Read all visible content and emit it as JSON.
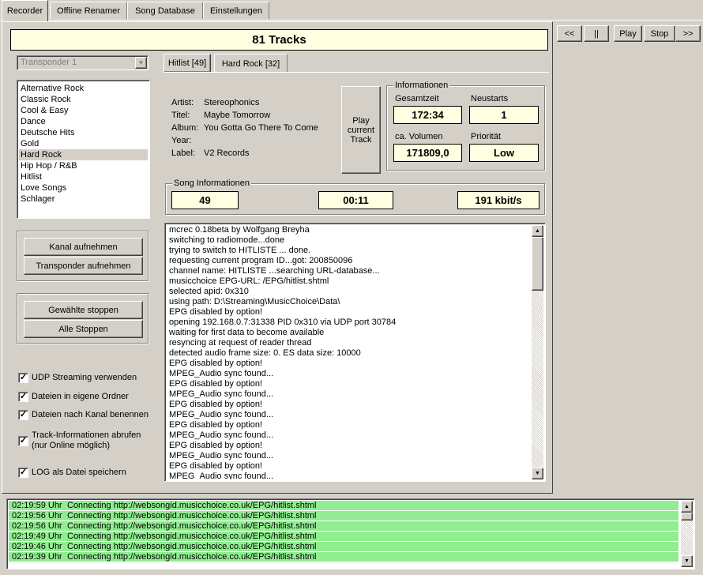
{
  "tabs": [
    {
      "label": "Recorder",
      "active": true
    },
    {
      "label": "Offline Renamer",
      "active": false
    },
    {
      "label": "Song Database",
      "active": false
    },
    {
      "label": "Einstellungen",
      "active": false
    }
  ],
  "player": {
    "prev": "<<",
    "pause": "||",
    "play": "Play",
    "stop": "Stop",
    "next": ">>"
  },
  "track_count": "81 Tracks",
  "transponder": {
    "selected": "Transponder 1"
  },
  "channels": [
    "Alternative Rock",
    "Classic Rock",
    "Cool & Easy",
    "Dance",
    "Deutsche Hits",
    "Gold",
    "Hard Rock",
    "Hip Hop / R&B",
    "Hitlist",
    "Love Songs",
    "Schlager"
  ],
  "selected_channel": "Hard Rock",
  "record_buttons": {
    "channel": "Kanal aufnehmen",
    "transponder": "Transponder aufnehmen"
  },
  "stop_buttons": {
    "selected": "Gewählte stoppen",
    "all": "Alle Stoppen"
  },
  "options": [
    {
      "label": "UDP Streaming verwenden",
      "checked": true
    },
    {
      "label": "Dateien in eigene Ordner",
      "checked": true
    },
    {
      "label": "Dateien nach Kanal benennen",
      "checked": true
    },
    {
      "label": "Track-Informationen abrufen",
      "sublabel": "(nur Online möglich)",
      "checked": true
    },
    {
      "label": "LOG als Datei speichern",
      "checked": true
    }
  ],
  "channel_tabs": [
    {
      "label": "Hitlist [49]",
      "active": true
    },
    {
      "label": "Hard Rock [32]",
      "active": false
    }
  ],
  "track": {
    "artist_label": "Artist:",
    "artist": "Stereophonics",
    "title_label": "Titel:",
    "title": "Maybe Tomorrow",
    "album_label": "Album:",
    "album": "You Gotta Go There To Come",
    "year_label": "Year:",
    "year": "",
    "label_label": "Label:",
    "label": "V2 Records"
  },
  "play_current": "Play current Track",
  "info": {
    "title": "Informationen",
    "total_label": "Gesamtzeit",
    "total": "172:34",
    "restarts_label": "Neustarts",
    "restarts": "1",
    "volume_label": "ca. Volumen",
    "volume": "171809,0",
    "priority_label": "Priorität",
    "priority": "Low"
  },
  "song_info": {
    "title": "Song Informationen",
    "number": "49",
    "time": "00:11",
    "bitrate": "191 kbit/s"
  },
  "log": [
    "mcrec 0.18beta by Wolfgang Breyha",
    "switching to radiomode...done",
    "trying to switch to HITLISTE ... done.",
    "requesting current program ID...got: 200850096",
    "channel name: HITLISTE ...searching URL-database...",
    "musicchoice EPG-URL: /EPG/hitlist.shtml",
    "selected apid: 0x310",
    "using path: D:\\Streaming\\MusicChoice\\Data\\",
    "EPG disabled by option!",
    "opening 192.168.0.7:31338 PID 0x310 via UDP port 30784",
    "waiting for first data to become available",
    "resyncing at request of reader thread",
    "detected audio frame size: 0. ES data size: 10000",
    "EPG disabled by option!",
    "MPEG_Audio sync found...",
    "EPG disabled by option!",
    "MPEG_Audio sync found...",
    "EPG disabled by option!",
    "MPEG_Audio sync found...",
    "EPG disabled by option!",
    "MPEG_Audio sync found...",
    "EPG disabled by option!",
    "MPEG_Audio sync found...",
    "EPG disabled by option!",
    "MPEG_Audio sync found..."
  ],
  "status_log": [
    {
      "time": "02:19:59 Uhr",
      "text": "Connecting http://websongid.musicchoice.co.uk/EPG/hitlist.shtml"
    },
    {
      "time": "02:19:56 Uhr",
      "text": "Connecting http://websongid.musicchoice.co.uk/EPG/hitlist.shtml"
    },
    {
      "time": "02:19:56 Uhr",
      "text": "Connecting http://websongid.musicchoice.co.uk/EPG/hitlist.shtml"
    },
    {
      "time": "02:19:49 Uhr",
      "text": "Connecting http://websongid.musicchoice.co.uk/EPG/hitlist.shtml"
    },
    {
      "time": "02:19:46 Uhr",
      "text": "Connecting http://websongid.musicchoice.co.uk/EPG/hitlist.shtml"
    },
    {
      "time": "02:19:39 Uhr",
      "text": "Connecting http://websongid.musicchoice.co.uk/EPG/hitlist.shtml"
    }
  ]
}
